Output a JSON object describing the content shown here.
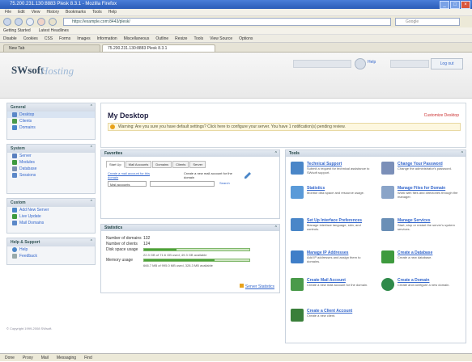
{
  "window": {
    "title": "75.200.231.130:8883 Plesk 8.3.1 - Mozilla Firefox"
  },
  "menu": [
    "File",
    "Edit",
    "View",
    "History",
    "Bookmarks",
    "Tools",
    "Help"
  ],
  "nav": {
    "url": "https://example.com:8443/plesk/",
    "search_placeholder": "Google"
  },
  "bookmarks": [
    "Getting Started",
    "Latest Headlines"
  ],
  "toolbar": [
    "Disable",
    "Cookies",
    "CSS",
    "Forms",
    "Images",
    "Information",
    "Miscellaneous",
    "Outline",
    "Resize",
    "Tools",
    "View Source",
    "Options"
  ],
  "tabs": [
    "New Tab",
    "75.200.231.130:8883 Plesk 8.3.1"
  ],
  "logo": {
    "word": "SWsoft",
    "hosting": "Hosting"
  },
  "header": {
    "logout": "Log out",
    "help": "Help"
  },
  "sidebar": {
    "general": {
      "title": "General",
      "items": [
        "Desktop",
        "Clients",
        "Domains"
      ]
    },
    "system": {
      "title": "System",
      "items": [
        "Server",
        "Modules",
        "Database",
        "Sessions"
      ]
    },
    "custom": {
      "title": "Custom",
      "items": [
        "Add New Server",
        "Live Update",
        "Mail Domains"
      ]
    },
    "help": {
      "title": "Help & Support",
      "items": [
        "Help",
        "Feedback"
      ]
    },
    "footer": "© Copyright 1999-2008 SWsoft."
  },
  "page": {
    "title": "My Desktop",
    "feed": "Customize Desktop",
    "notice": "Warning: Are you sure you have default settings? Click here to configure your server. You have 1 notification(s) pending review."
  },
  "favorites": {
    "title": "Favorites",
    "tabs": [
      "Start Up",
      "Mail Accounts",
      "Domains",
      "Clients",
      "Server"
    ],
    "desc": "Create a new mail account for the domain",
    "link": "Create a mail account for this domain",
    "select": "Mail accounts",
    "search": "Search"
  },
  "statistics": {
    "title": "Statistics",
    "rows": [
      [
        "Number of domains",
        "132"
      ],
      [
        "Number of clients",
        "124"
      ],
      [
        "Disk space usage",
        ""
      ],
      [
        "Memory usage",
        ""
      ]
    ],
    "disk_label": "22.3 GB of 71.6 GB used, 49.3 GB available",
    "disk_fill": 0.31,
    "mem_label": "666.7 MB of 995.0 MB used, 328.3 MB available",
    "mem_fill": 0.67,
    "more": "Server Statistics"
  },
  "tasks": {
    "title": "Tools",
    "items": [
      {
        "title": "Technical Support",
        "desc": "Submit a request for technical assistance to SWsoft support."
      },
      {
        "title": "Change Your Password",
        "desc": "Change the administrator's password."
      },
      {
        "title": "Statistics",
        "desc": "Monitor disk space and resource usage."
      },
      {
        "title": "Manage Files for Domain",
        "desc": "Work with files and directories through the manager."
      },
      {
        "title": "Set Up Interface Preferences",
        "desc": "Manage interface language, skin, and controls."
      },
      {
        "title": "Manage Services",
        "desc": "Start, stop or restart the server's system services."
      },
      {
        "title": "Manage IP Addresses",
        "desc": "Add IP addresses and assign them to domains."
      },
      {
        "title": "Create a Database",
        "desc": "Create a new database."
      },
      {
        "title": "Create Mail Account",
        "desc": "Create a new mail account for the domain."
      },
      {
        "title": "Create a Domain",
        "desc": "Create and configure a new domain."
      },
      {
        "title": "Create a Client Account",
        "desc": "Create a new client."
      }
    ]
  },
  "status": [
    "Done",
    "Proxy",
    "Mail",
    "Messaging",
    "Find"
  ]
}
